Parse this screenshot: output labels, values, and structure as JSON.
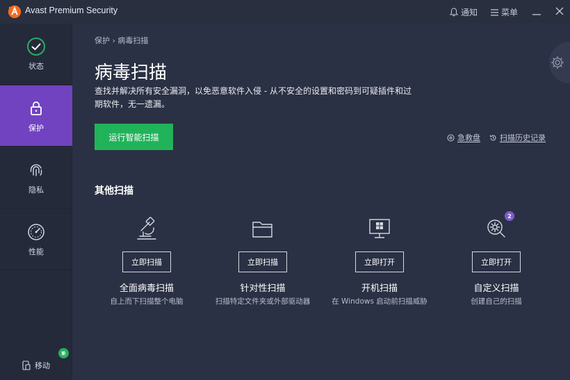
{
  "titlebar": {
    "app_title": "Avast Premium Security",
    "notify_label": "通知",
    "menu_label": "菜单",
    "icons": [
      "avast-logo",
      "bell-icon",
      "hamburger-icon",
      "minimize-icon",
      "close-icon"
    ]
  },
  "sidebar": {
    "items": [
      {
        "label": "状态",
        "icon": "check-circle-icon"
      },
      {
        "label": "保护",
        "icon": "lock-icon",
        "active": true
      },
      {
        "label": "隐私",
        "icon": "fingerprint-icon"
      },
      {
        "label": "性能",
        "icon": "gauge-icon"
      }
    ],
    "mobile_label": "移动",
    "mobile_badge": "新"
  },
  "main": {
    "breadcrumb": "保护 › 病毒扫描",
    "title": "病毒扫描",
    "description": "查找并解决所有安全漏洞，以免恶意软件入侵 - 从不安全的设置和密码到可疑插件和过期软件，无一遗漏。",
    "run_button": "运行智能扫描",
    "links": {
      "rescue": "急救盘",
      "history": "扫描历史记录"
    },
    "section_title": "其他扫描",
    "scans": [
      {
        "icon": "microscope-icon",
        "button": "立即扫描",
        "name": "全面病毒扫描",
        "desc": "自上而下扫描整个电脑"
      },
      {
        "icon": "folder-icon",
        "button": "立即扫描",
        "name": "针对性扫描",
        "desc": "扫描特定文件夹或外部驱动器"
      },
      {
        "icon": "windows-monitor-icon",
        "button": "立即打开",
        "name": "开机扫描",
        "desc": "在 Windows 启动前扫描威胁"
      },
      {
        "icon": "gear-magnifier-icon",
        "button": "立即打开",
        "name": "自定义扫描",
        "desc": "创建自己的扫描",
        "badge": "2"
      }
    ]
  },
  "colors": {
    "background": "#2b3144",
    "sidebar": "#252a3a",
    "active_nav": "#7143c0",
    "primary_button": "#21b35a",
    "status_green": "#27ae60",
    "logo_orange": "#f26b1d"
  }
}
